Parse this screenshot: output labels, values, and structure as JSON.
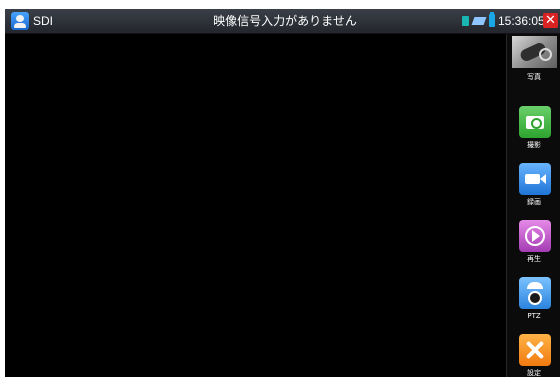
{
  "window": {
    "app_name": "SDI",
    "title": "映像信号入力がありません",
    "clock": "15:36:05",
    "close_label": "✕"
  },
  "icons": {
    "app": "sdi-app-icon",
    "status": [
      "sd-card-icon",
      "usb-icon",
      "battery-icon"
    ],
    "close": "close-icon"
  },
  "toolbar": {
    "items": [
      {
        "label": "写真",
        "icon": "photos-icon"
      },
      {
        "label": "撮影",
        "icon": "camera-icon"
      },
      {
        "label": "録画",
        "icon": "video-record-icon"
      },
      {
        "label": "再生",
        "icon": "play-icon"
      },
      {
        "label": "PTZ",
        "icon": "ptz-camera-icon"
      },
      {
        "label": "設定",
        "icon": "settings-tools-icon"
      }
    ]
  },
  "colors": {
    "titlebar": "#2b2e34",
    "background": "#000000",
    "close": "#d92323"
  }
}
